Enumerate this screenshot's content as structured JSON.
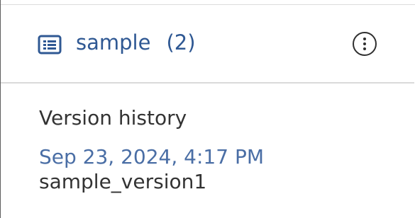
{
  "header": {
    "icon": "list-icon",
    "title": "sample",
    "count": "(2)",
    "more_icon": "more-vertical-icon"
  },
  "version_history": {
    "heading": "Version history",
    "entries": [
      {
        "date": "Sep 23, 2024, 4:17 PM",
        "name": "sample_version1"
      }
    ]
  },
  "colors": {
    "accent": "#2f5893",
    "date_link": "#4a6ea5",
    "text": "#333333",
    "divider": "#dadada"
  }
}
